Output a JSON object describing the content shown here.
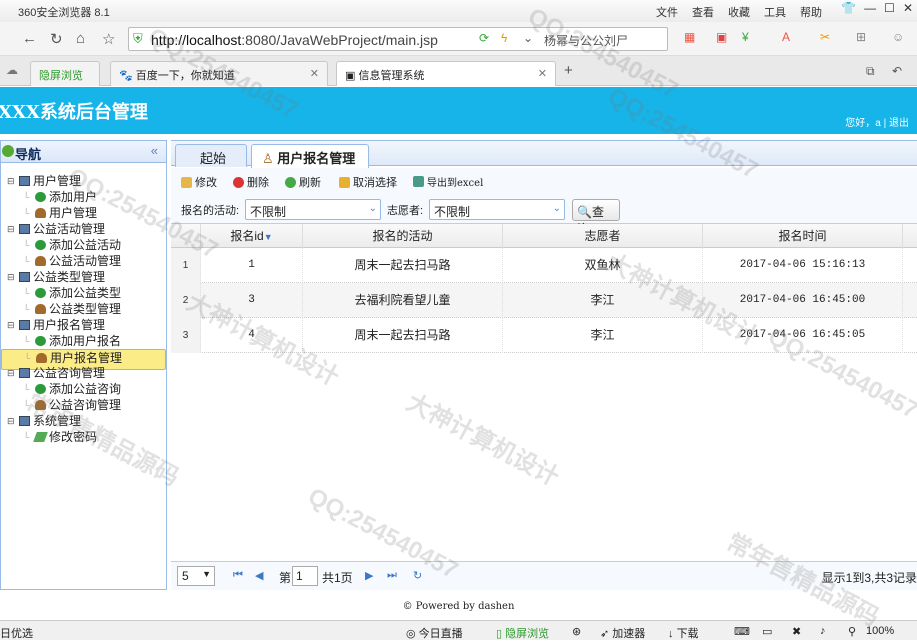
{
  "browser": {
    "title": "360安全浏览器 8.1",
    "menu": [
      "文件",
      "查看",
      "收藏",
      "工具",
      "帮助"
    ],
    "url_host": "http://localhost",
    "url_rest": ":8080/JavaWebProject/main.jsp",
    "search_text": "杨幂与公公刘尸",
    "tabs": [
      {
        "label": "隐屏浏览"
      },
      {
        "label": "百度一下，你就知道"
      },
      {
        "label": "信息管理系统"
      }
    ]
  },
  "app": {
    "brand": "XXX系统后台管理",
    "user_text": "您好，a",
    "separator": "|",
    "logout": "退出"
  },
  "sidebar": {
    "title": "导航",
    "groups": [
      {
        "label": "用户管理",
        "items": [
          "添加用户",
          "用户管理"
        ]
      },
      {
        "label": "公益活动管理",
        "items": [
          "添加公益活动",
          "公益活动管理"
        ]
      },
      {
        "label": "公益类型管理",
        "items": [
          "添加公益类型",
          "公益类型管理"
        ]
      },
      {
        "label": "用户报名管理",
        "items": [
          "添加用户报名",
          "用户报名管理"
        ]
      },
      {
        "label": "公益咨询管理",
        "items": [
          "添加公益咨询",
          "公益咨询管理"
        ]
      },
      {
        "label": "系统管理",
        "items": [
          "修改密码"
        ]
      }
    ]
  },
  "tabs": [
    {
      "label": "起始页"
    },
    {
      "label": "用户报名管理"
    }
  ],
  "toolbar": {
    "edit": "修改",
    "delete": "删除",
    "refresh": "刷新",
    "unselect": "取消选择",
    "export": "导出到excel"
  },
  "filter": {
    "activity_label": "报名的活动:",
    "activity_value": "不限制",
    "volunteer_label": "志愿者:",
    "volunteer_value": "不限制",
    "query": "查询"
  },
  "grid": {
    "columns": [
      "报名id",
      "报名的活动",
      "志愿者",
      "报名时间"
    ],
    "rows": [
      {
        "n": "1",
        "id": "1",
        "activity": "周末一起去扫马路",
        "volunteer": "双鱼林",
        "time": "2017-04-06 15:16:13"
      },
      {
        "n": "2",
        "id": "3",
        "activity": "去福利院看望儿童",
        "volunteer": "李江",
        "time": "2017-04-06 16:45:00"
      },
      {
        "n": "3",
        "id": "4",
        "activity": "周末一起去扫马路",
        "volunteer": "李江",
        "time": "2017-04-06 16:45:05"
      }
    ]
  },
  "pager": {
    "page_size": "5",
    "page_prefix": "第",
    "page": "1",
    "page_suffix": "共1页",
    "summary": "显示1到3,共3记录"
  },
  "footer": "© Powered by dashen",
  "statusbar": {
    "left": "日优选",
    "items": [
      "今日直播",
      "隐屏浏览",
      "加速器",
      "下载"
    ],
    "zoom": "100%"
  },
  "watermarks": [
    "QQ:254540457",
    "大神计算机设计",
    "常年售精品源码"
  ]
}
